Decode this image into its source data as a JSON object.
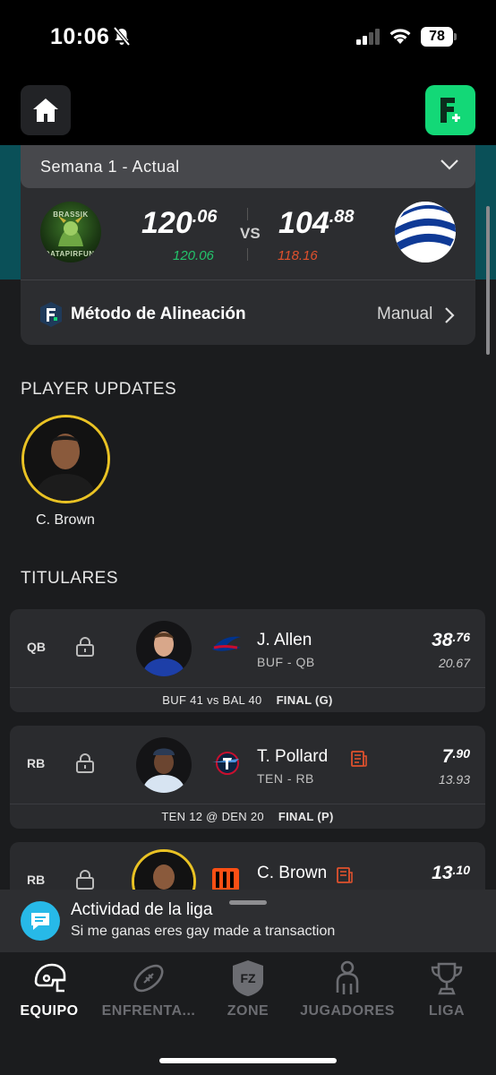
{
  "status_bar": {
    "time": "10:06",
    "battery": "78"
  },
  "matchup": {
    "week_label": "Semana 1 - Actual",
    "left_team": {
      "logo_text_top": "BRASSIK",
      "logo_text_bottom": "DATAPIRFUNI",
      "score_int": "120",
      "score_dec": ".06",
      "projected": "120.06"
    },
    "vs_label": "VS",
    "right_team": {
      "score_int": "104",
      "score_dec": ".88",
      "projected": "118.16"
    },
    "lineup_method_label": "Método de Alineación",
    "lineup_method_value": "Manual"
  },
  "player_updates": {
    "title": "PLAYER UPDATES",
    "items": [
      {
        "name": "C. Brown"
      }
    ]
  },
  "starters": {
    "title": "TITULARES",
    "players": [
      {
        "pos": "QB",
        "name": "J. Allen",
        "team_pos": "BUF - QB",
        "pts_int": "38",
        "pts_dec": ".76",
        "proj": "20.67",
        "game": "BUF 41 vs BAL 40",
        "status": "FINAL (G)"
      },
      {
        "pos": "RB",
        "name": "T. Pollard",
        "team_pos": "TEN - RB",
        "pts_int": "7",
        "pts_dec": ".90",
        "proj": "13.93",
        "game": "TEN 12 @ DEN 20",
        "status": "FINAL (P)"
      },
      {
        "pos": "RB",
        "name": "C. Brown",
        "team_pos": "",
        "pts_int": "13",
        "pts_dec": ".10",
        "proj": "",
        "game": "",
        "status": ""
      }
    ]
  },
  "toast": {
    "title": "Actividad de la liga",
    "body": "Si me ganas eres gay made a transaction"
  },
  "tabs": [
    {
      "label": "EQUIPO",
      "icon": "helmet-icon",
      "active": true
    },
    {
      "label": "ENFRENTA...",
      "icon": "football-icon",
      "active": false
    },
    {
      "label": "ZONE",
      "icon": "fz-shield-icon",
      "active": false
    },
    {
      "label": "JUGADORES",
      "icon": "person-icon",
      "active": false
    },
    {
      "label": "LIGA",
      "icon": "trophy-icon",
      "active": false
    }
  ],
  "colors": {
    "accent_green": "#13d877",
    "positive": "#23c46b",
    "negative": "#e0512d",
    "gold_ring": "#e9c224",
    "toast_icon": "#27b9e8"
  }
}
